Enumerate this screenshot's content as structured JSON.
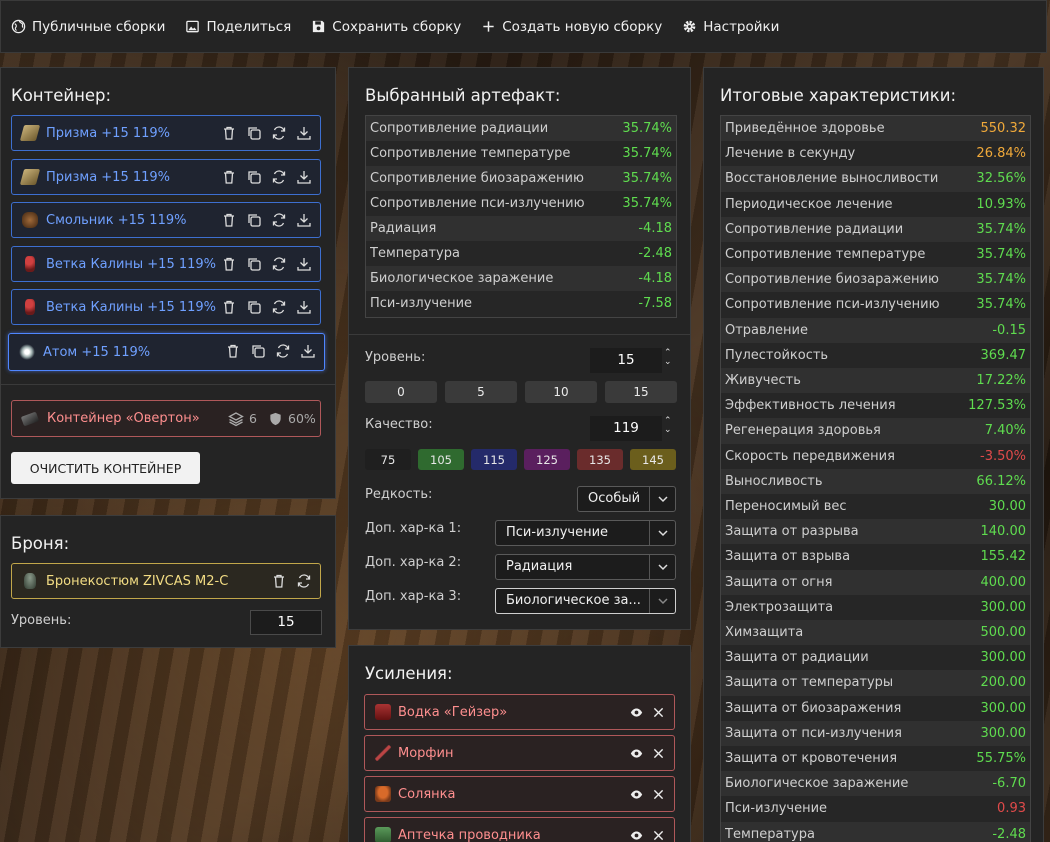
{
  "nav": [
    "Публичные сборки",
    "Поделиться",
    "Сохранить сборку",
    "Создать новую сборку",
    "Настройки"
  ],
  "container": {
    "title": "Контейнер:",
    "items": [
      {
        "name": "Призма +15 119%",
        "icon": "prism-artifact-icon"
      },
      {
        "name": "Призма +15 119%",
        "icon": "prism-artifact-icon"
      },
      {
        "name": "Смольник +15 119%",
        "icon": "smolnik-artifact-icon"
      },
      {
        "name": "Ветка Калины +15 119%",
        "icon": "kalina-branch-artifact-icon"
      },
      {
        "name": "Ветка Калины +15 119%",
        "icon": "kalina-branch-artifact-icon"
      },
      {
        "name": "Атом +15 119%",
        "icon": "atom-artifact-icon"
      }
    ],
    "box": {
      "name": "Контейнер «Овертон»",
      "slots": "6",
      "protection": "60%"
    },
    "clear_label": "ОЧИСТИТЬ КОНТЕЙНЕР"
  },
  "armor": {
    "title": "Броня:",
    "name": "Бронекостюм ZIVCAS M2-C",
    "level_label": "Уровень:",
    "level": "15"
  },
  "artifact": {
    "title": "Выбранный артефакт:",
    "stats": [
      {
        "l": "Сопротивление радиации",
        "v": "35.74%",
        "c": "#5fdc4f"
      },
      {
        "l": "Сопротивление температуре",
        "v": "35.74%",
        "c": "#5fdc4f"
      },
      {
        "l": "Сопротивление биозаражению",
        "v": "35.74%",
        "c": "#5fdc4f"
      },
      {
        "l": "Сопротивление пси-излучению",
        "v": "35.74%",
        "c": "#5fdc4f"
      },
      {
        "l": "Радиация",
        "v": "-4.18",
        "c": "#5fdc4f"
      },
      {
        "l": "Температура",
        "v": "-2.48",
        "c": "#5fdc4f"
      },
      {
        "l": "Биологическое заражение",
        "v": "-4.18",
        "c": "#5fdc4f"
      },
      {
        "l": "Пси-излучение",
        "v": "-7.58",
        "c": "#5fdc4f"
      }
    ],
    "level_label": "Уровень:",
    "level": "15",
    "level_presets": [
      "0",
      "5",
      "10",
      "15"
    ],
    "quality_label": "Качество:",
    "quality": "119",
    "quality_presets": [
      {
        "v": "75",
        "bg": "#1f1f1f"
      },
      {
        "v": "105",
        "bg": "#2f6a2f"
      },
      {
        "v": "115",
        "bg": "#242a6a"
      },
      {
        "v": "125",
        "bg": "#5a1f5e"
      },
      {
        "v": "135",
        "bg": "#6a2c2c"
      },
      {
        "v": "145",
        "bg": "#6b5e1c"
      }
    ],
    "rarity_label": "Редкость:",
    "rarity": "Особый",
    "extra1_label": "Доп. хар-ка 1:",
    "extra1": "Пси-излучение",
    "extra2_label": "Доп. хар-ка 2:",
    "extra2": "Радиация",
    "extra3_label": "Доп. хар-ка 3:",
    "extra3": "Биологическое за..."
  },
  "boosts": {
    "title": "Усиления:",
    "items": [
      {
        "name": "Водка «Гейзер»",
        "icon": "vodka-bottle-icon"
      },
      {
        "name": "Морфин",
        "icon": "morphine-syringe-icon"
      },
      {
        "name": "Солянка",
        "icon": "soup-bowl-icon"
      },
      {
        "name": "Аптечка проводника",
        "icon": "medkit-icon"
      }
    ]
  },
  "totals": {
    "title": "Итоговые характеристики:",
    "rows": [
      {
        "l": "Приведённое здоровье",
        "v": "550.32",
        "c": "#f0a93a"
      },
      {
        "l": "Лечение в секунду",
        "v": "26.84%",
        "c": "#f0a93a"
      },
      {
        "l": "Восстановление выносливости",
        "v": "32.56%",
        "c": "#5fdc4f"
      },
      {
        "l": "Периодическое лечение",
        "v": "10.93%",
        "c": "#5fdc4f"
      },
      {
        "l": "Сопротивление радиации",
        "v": "35.74%",
        "c": "#5fdc4f"
      },
      {
        "l": "Сопротивление температуре",
        "v": "35.74%",
        "c": "#5fdc4f"
      },
      {
        "l": "Сопротивление биозаражению",
        "v": "35.74%",
        "c": "#5fdc4f"
      },
      {
        "l": "Сопротивление пси-излучению",
        "v": "35.74%",
        "c": "#5fdc4f"
      },
      {
        "l": "Отравление",
        "v": "-0.15",
        "c": "#5fdc4f"
      },
      {
        "l": "Пулестойкость",
        "v": "369.47",
        "c": "#5fdc4f"
      },
      {
        "l": "Живучесть",
        "v": "17.22%",
        "c": "#5fdc4f"
      },
      {
        "l": "Эффективность лечения",
        "v": "127.53%",
        "c": "#5fdc4f"
      },
      {
        "l": "Регенерация здоровья",
        "v": "7.40%",
        "c": "#5fdc4f"
      },
      {
        "l": "Скорость передвижения",
        "v": "-3.50%",
        "c": "#e04a4a"
      },
      {
        "l": "Выносливость",
        "v": "66.12%",
        "c": "#5fdc4f"
      },
      {
        "l": "Переносимый вес",
        "v": "30.00",
        "c": "#5fdc4f"
      },
      {
        "l": "Защита от разрыва",
        "v": "140.00",
        "c": "#5fdc4f"
      },
      {
        "l": "Защита от взрыва",
        "v": "155.42",
        "c": "#5fdc4f"
      },
      {
        "l": "Защита от огня",
        "v": "400.00",
        "c": "#5fdc4f"
      },
      {
        "l": "Электрозащита",
        "v": "300.00",
        "c": "#5fdc4f"
      },
      {
        "l": "Химзащита",
        "v": "500.00",
        "c": "#5fdc4f"
      },
      {
        "l": "Защита от радиации",
        "v": "300.00",
        "c": "#5fdc4f"
      },
      {
        "l": "Защита от температуры",
        "v": "200.00",
        "c": "#5fdc4f"
      },
      {
        "l": "Защита от биозаражения",
        "v": "300.00",
        "c": "#5fdc4f"
      },
      {
        "l": "Защита от пси-излучения",
        "v": "300.00",
        "c": "#5fdc4f"
      },
      {
        "l": "Защита от кровотечения",
        "v": "55.75%",
        "c": "#5fdc4f"
      },
      {
        "l": "Биологическое заражение",
        "v": "-6.70",
        "c": "#5fdc4f"
      },
      {
        "l": "Пси-излучение",
        "v": "0.93",
        "c": "#e04a4a"
      },
      {
        "l": "Температура",
        "v": "-2.48",
        "c": "#5fdc4f"
      }
    ]
  }
}
